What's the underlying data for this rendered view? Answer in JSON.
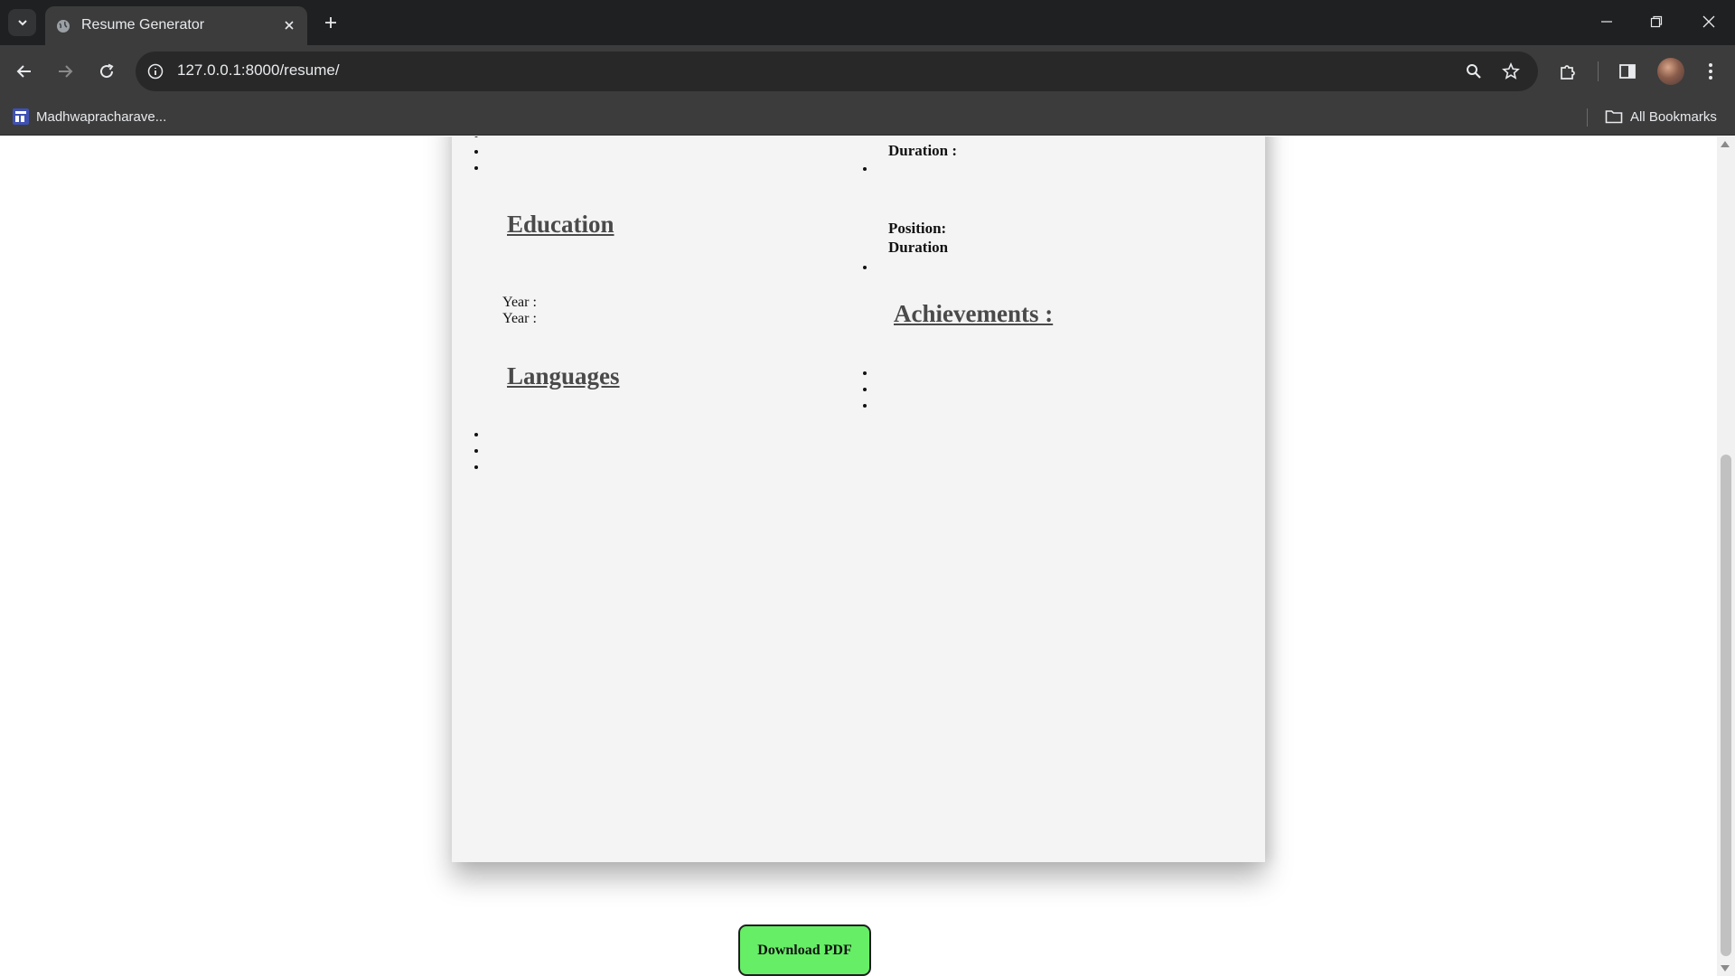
{
  "browser": {
    "tab_title": "Resume Generator",
    "url": "127.0.0.1:8000/resume/",
    "bookmark": "Madhwapracharave...",
    "all_bookmarks": "All Bookmarks"
  },
  "resume": {
    "left": {
      "education_title": "Education",
      "year_1": "Year :",
      "year_2": "Year :",
      "languages_title": "Languages"
    },
    "right": {
      "duration_1": "Duration :",
      "position": "Position:",
      "duration_2": "Duration",
      "achievements_title": "Achievements :"
    }
  },
  "download_label": "Download PDF",
  "colors": {
    "download_button": "#66ee66",
    "resume_background": "#f4f4f4",
    "section_title": "#4a4a4a"
  }
}
